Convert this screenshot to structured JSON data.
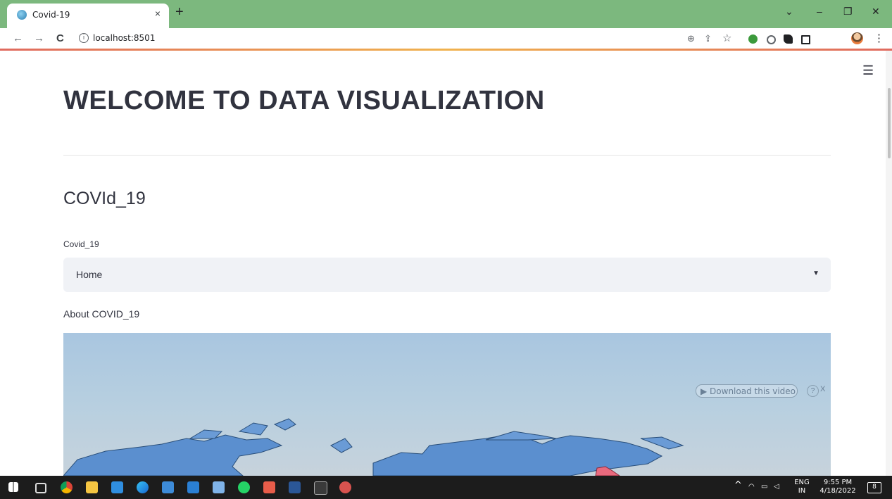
{
  "browser": {
    "tab_title": "Covid-19",
    "tab_close": "×",
    "new_tab": "+",
    "url": "localhost:8501",
    "window_controls": {
      "menu": "⌄",
      "minimize": "–",
      "restore": "❐",
      "close": "✕"
    },
    "nav": {
      "back": "←",
      "forward": "→",
      "reload": "C"
    },
    "toolbar_icons": {
      "zoom": "⊕",
      "share": "⇪",
      "bookmark": "☆",
      "menu": "⋮"
    }
  },
  "app": {
    "menu_icon": "☰",
    "title": "WELCOME TO DATA VISUALIZATION",
    "subheader": "COVId_19",
    "select": {
      "label": "Covid_19",
      "value": "Home",
      "caret": "▼"
    },
    "about_text": "About COVID_19",
    "video_overlay": {
      "download": "Download this video",
      "help": "?",
      "close": "X"
    }
  },
  "taskbar": {
    "tray_chevron": "^",
    "language": "ENG",
    "region": "IN",
    "time": "9:55 PM",
    "date": "4/18/2022",
    "notifications": "8"
  },
  "colors": {
    "tab_strip": "#7cb87e",
    "select_bg": "#f0f2f6",
    "text": "#31333f",
    "map_land": "#5b8fcf",
    "map_highlight": "#e96a7e",
    "taskbar": "#1c1c1c"
  }
}
